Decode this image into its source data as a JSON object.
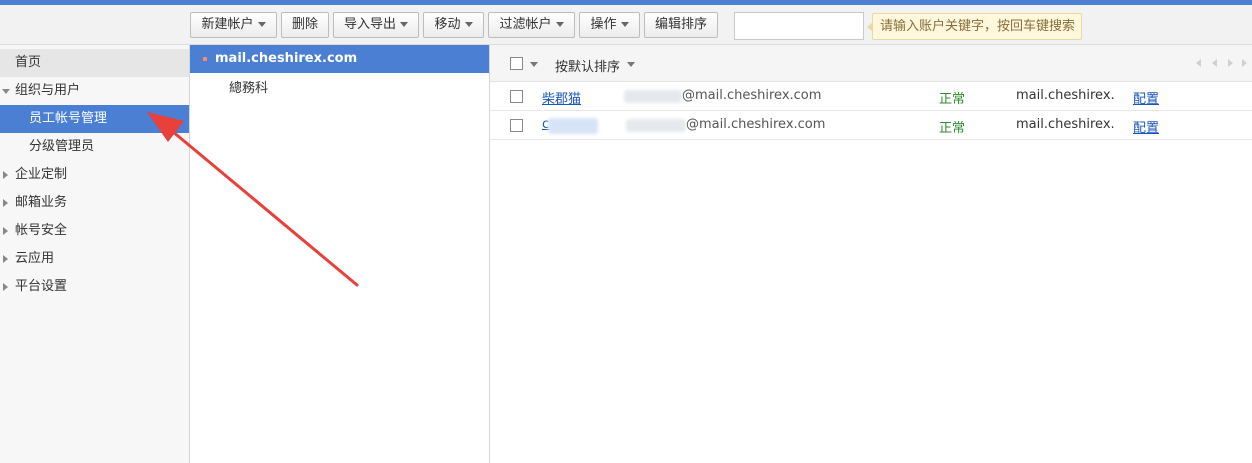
{
  "toolbar": {
    "buttons": [
      {
        "label": "新建帐户",
        "dropdown": true
      },
      {
        "label": "删除",
        "dropdown": false
      },
      {
        "label": "导入导出",
        "dropdown": true
      },
      {
        "label": "移动",
        "dropdown": true
      },
      {
        "label": "过滤帐户",
        "dropdown": true
      },
      {
        "label": "操作",
        "dropdown": true
      },
      {
        "label": "编辑排序",
        "dropdown": false
      }
    ],
    "search": {
      "value": "",
      "hint": "请输入账户关键字，按回车键搜索"
    }
  },
  "sidebar": {
    "items": [
      {
        "label": "首页"
      },
      {
        "label": "组织与用户"
      },
      {
        "label": "员工帐号管理"
      },
      {
        "label": "分级管理员"
      },
      {
        "label": "企业定制"
      },
      {
        "label": "邮箱业务"
      },
      {
        "label": "帐号安全"
      },
      {
        "label": "云应用"
      },
      {
        "label": "平台设置"
      }
    ]
  },
  "org": {
    "root": "mail.cheshirex.com",
    "children": [
      "總務科"
    ]
  },
  "list": {
    "sort_label": "按默认排序",
    "rows": [
      {
        "name": "柴郡猫",
        "email_suffix": "@mail.cheshirex.com",
        "status": "正常",
        "domain": "mail.cheshirex.…",
        "action": "配置"
      },
      {
        "name": "c",
        "email_suffix": "@mail.cheshirex.com",
        "status": "正常",
        "domain": "mail.cheshirex.…",
        "action": "配置"
      }
    ]
  },
  "colors": {
    "accent": "#4a7fd4",
    "arrow": "#e8403a",
    "status_green": "#2e8b2e",
    "link": "#1a56b8"
  }
}
